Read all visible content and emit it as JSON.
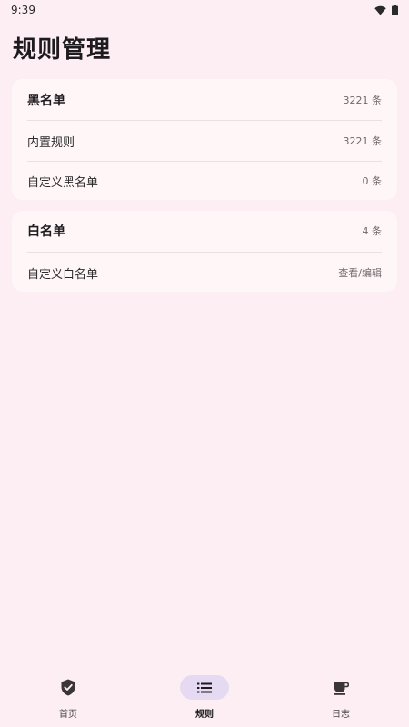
{
  "status_bar": {
    "time": "9:39",
    "icons": [
      "wifi-icon",
      "battery-icon"
    ]
  },
  "page": {
    "title": "规则管理"
  },
  "blacklist": {
    "title": "黑名单",
    "count": "3221 条",
    "rows": [
      {
        "label": "内置规则",
        "value": "3221 条"
      },
      {
        "label": "自定义黑名单",
        "value": "0 条"
      }
    ]
  },
  "whitelist": {
    "title": "白名单",
    "count": "4 条",
    "rows": [
      {
        "label": "自定义白名单",
        "value": "查看/编辑"
      }
    ]
  },
  "bottom_nav": {
    "items": [
      {
        "label": "首页",
        "icon": "shield-check-icon",
        "active": false
      },
      {
        "label": "规则",
        "icon": "list-icon",
        "active": true
      },
      {
        "label": "日志",
        "icon": "coffee-cup-icon",
        "active": false
      }
    ]
  },
  "colors": {
    "background": "#fdeef3",
    "card": "#fff6f8",
    "active_pill": "#e5daf1",
    "text_primary": "#1d1b1e",
    "text_secondary": "#6f6a6d"
  }
}
